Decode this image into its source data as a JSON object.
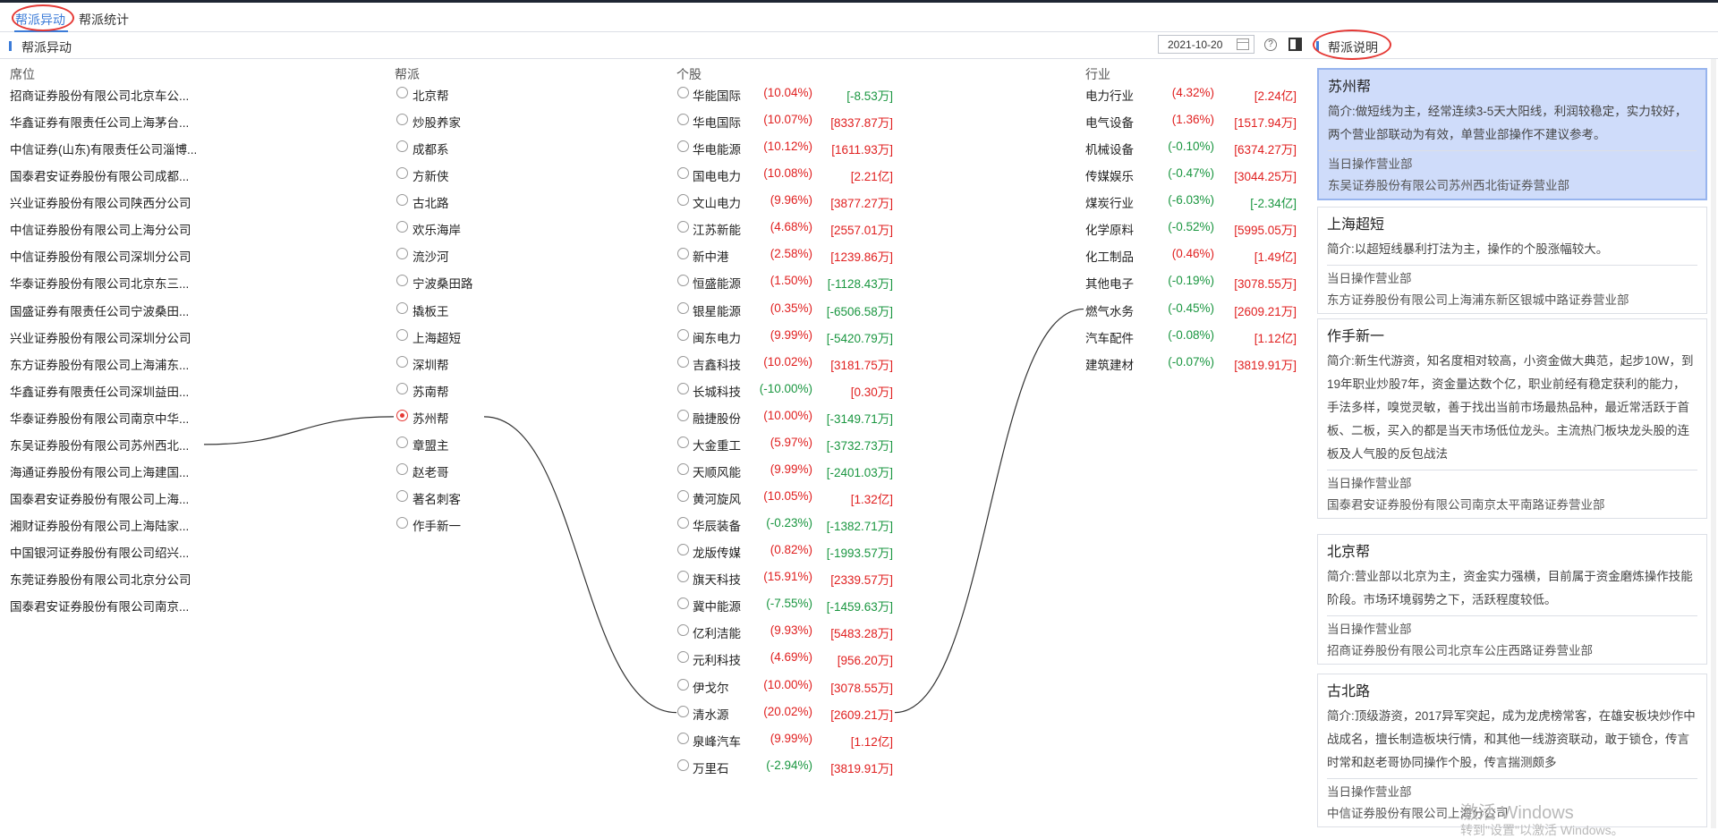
{
  "tabs": [
    {
      "label": "帮派异动",
      "active": true
    },
    {
      "label": "帮派统计",
      "active": false
    }
  ],
  "left_panel": {
    "title": "帮派异动",
    "date": "2021-10-20"
  },
  "right_panel": {
    "title": "帮派说明"
  },
  "columns": {
    "seat": "席位",
    "gang": "帮派",
    "stock": "个股",
    "industry": "行业"
  },
  "seats": [
    "招商证券股份有限公司北京车公...",
    "华鑫证券有限责任公司上海茅台...",
    "中信证券(山东)有限责任公司淄博...",
    "国泰君安证券股份有限公司成都...",
    "兴业证券股份有限公司陕西分公司",
    "中信证券股份有限公司上海分公司",
    "中信证券股份有限公司深圳分公司",
    "华泰证券股份有限公司北京东三...",
    "国盛证券有限责任公司宁波桑田...",
    "兴业证券股份有限公司深圳分公司",
    "东方证券股份有限公司上海浦东...",
    "华鑫证券有限责任公司深圳益田...",
    "华泰证券股份有限公司南京中华...",
    "东吴证券股份有限公司苏州西北...",
    "海通证券股份有限公司上海建国...",
    "国泰君安证券股份有限公司上海...",
    "湘财证券股份有限公司上海陆家...",
    "中国银河证券股份有限公司绍兴...",
    "东莞证券股份有限公司北京分公司",
    "国泰君安证券股份有限公司南京..."
  ],
  "gangs": [
    {
      "label": "北京帮",
      "checked": false
    },
    {
      "label": "炒股养家",
      "checked": false
    },
    {
      "label": "成都系",
      "checked": false
    },
    {
      "label": "方新侠",
      "checked": false
    },
    {
      "label": "古北路",
      "checked": false
    },
    {
      "label": "欢乐海岸",
      "checked": false
    },
    {
      "label": "流沙河",
      "checked": false
    },
    {
      "label": "宁波桑田路",
      "checked": false
    },
    {
      "label": "撬板王",
      "checked": false
    },
    {
      "label": "上海超短",
      "checked": false
    },
    {
      "label": "深圳帮",
      "checked": false
    },
    {
      "label": "苏南帮",
      "checked": false
    },
    {
      "label": "苏州帮",
      "checked": true
    },
    {
      "label": "章盟主",
      "checked": false
    },
    {
      "label": "赵老哥",
      "checked": false
    },
    {
      "label": "著名刺客",
      "checked": false
    },
    {
      "label": "作手新一",
      "checked": false
    }
  ],
  "stocks": [
    {
      "name": "华能国际",
      "pct": "(10.04%)",
      "amount": "[-8.53万]",
      "pct_color": "red",
      "amount_color": "green"
    },
    {
      "name": "华电国际",
      "pct": "(10.07%)",
      "amount": "[8337.87万]",
      "pct_color": "red",
      "amount_color": "red"
    },
    {
      "name": "华电能源",
      "pct": "(10.12%)",
      "amount": "[1611.93万]",
      "pct_color": "red",
      "amount_color": "red"
    },
    {
      "name": "国电电力",
      "pct": "(10.08%)",
      "amount": "[2.21亿]",
      "pct_color": "red",
      "amount_color": "red"
    },
    {
      "name": "文山电力",
      "pct": "(9.96%)",
      "amount": "[3877.27万]",
      "pct_color": "red",
      "amount_color": "red"
    },
    {
      "name": "江苏新能",
      "pct": "(4.68%)",
      "amount": "[2557.01万]",
      "pct_color": "red",
      "amount_color": "red"
    },
    {
      "name": "新中港",
      "pct": "(2.58%)",
      "amount": "[1239.86万]",
      "pct_color": "red",
      "amount_color": "red"
    },
    {
      "name": "恒盛能源",
      "pct": "(1.50%)",
      "amount": "[-1128.43万]",
      "pct_color": "red",
      "amount_color": "green"
    },
    {
      "name": "银星能源",
      "pct": "(0.35%)",
      "amount": "[-6506.58万]",
      "pct_color": "red",
      "amount_color": "green"
    },
    {
      "name": "闽东电力",
      "pct": "(9.99%)",
      "amount": "[-5420.79万]",
      "pct_color": "red",
      "amount_color": "green"
    },
    {
      "name": "吉鑫科技",
      "pct": "(10.02%)",
      "amount": "[3181.75万]",
      "pct_color": "red",
      "amount_color": "red"
    },
    {
      "name": "长城科技",
      "pct": "(-10.00%)",
      "amount": "[0.30万]",
      "pct_color": "green",
      "amount_color": "red"
    },
    {
      "name": "融捷股份",
      "pct": "(10.00%)",
      "amount": "[-3149.71万]",
      "pct_color": "red",
      "amount_color": "green"
    },
    {
      "name": "大金重工",
      "pct": "(5.97%)",
      "amount": "[-3732.73万]",
      "pct_color": "red",
      "amount_color": "green"
    },
    {
      "name": "天顺风能",
      "pct": "(9.99%)",
      "amount": "[-2401.03万]",
      "pct_color": "red",
      "amount_color": "green"
    },
    {
      "name": "黄河旋风",
      "pct": "(10.05%)",
      "amount": "[1.32亿]",
      "pct_color": "red",
      "amount_color": "red"
    },
    {
      "name": "华辰装备",
      "pct": "(-0.23%)",
      "amount": "[-1382.71万]",
      "pct_color": "green",
      "amount_color": "green"
    },
    {
      "name": "龙版传媒",
      "pct": "(0.82%)",
      "amount": "[-1993.57万]",
      "pct_color": "red",
      "amount_color": "green"
    },
    {
      "name": "旗天科技",
      "pct": "(15.91%)",
      "amount": "[2339.57万]",
      "pct_color": "red",
      "amount_color": "red"
    },
    {
      "name": "冀中能源",
      "pct": "(-7.55%)",
      "amount": "[-1459.63万]",
      "pct_color": "green",
      "amount_color": "green"
    },
    {
      "name": "亿利洁能",
      "pct": "(9.93%)",
      "amount": "[5483.28万]",
      "pct_color": "red",
      "amount_color": "red"
    },
    {
      "name": "元利科技",
      "pct": "(4.69%)",
      "amount": "[956.20万]",
      "pct_color": "red",
      "amount_color": "red"
    },
    {
      "name": "伊戈尔",
      "pct": "(10.00%)",
      "amount": "[3078.55万]",
      "pct_color": "red",
      "amount_color": "red"
    },
    {
      "name": "清水源",
      "pct": "(20.02%)",
      "amount": "[2609.21万]",
      "pct_color": "red",
      "amount_color": "red"
    },
    {
      "name": "泉峰汽车",
      "pct": "(9.99%)",
      "amount": "[1.12亿]",
      "pct_color": "red",
      "amount_color": "red"
    },
    {
      "name": "万里石",
      "pct": "(-2.94%)",
      "amount": "[3819.91万]",
      "pct_color": "green",
      "amount_color": "red"
    }
  ],
  "industries": [
    {
      "name": "电力行业",
      "pct": "(4.32%)",
      "amount": "[2.24亿]",
      "pct_color": "red",
      "amount_color": "red"
    },
    {
      "name": "电气设备",
      "pct": "(1.36%)",
      "amount": "[1517.94万]",
      "pct_color": "red",
      "amount_color": "red"
    },
    {
      "name": "机械设备",
      "pct": "(-0.10%)",
      "amount": "[6374.27万]",
      "pct_color": "green",
      "amount_color": "red"
    },
    {
      "name": "传媒娱乐",
      "pct": "(-0.47%)",
      "amount": "[3044.25万]",
      "pct_color": "green",
      "amount_color": "red"
    },
    {
      "name": "煤炭行业",
      "pct": "(-6.03%)",
      "amount": "[-2.34亿]",
      "pct_color": "green",
      "amount_color": "green"
    },
    {
      "name": "化学原料",
      "pct": "(-0.52%)",
      "amount": "[5995.05万]",
      "pct_color": "green",
      "amount_color": "red"
    },
    {
      "name": "化工制品",
      "pct": "(0.46%)",
      "amount": "[1.49亿]",
      "pct_color": "red",
      "amount_color": "red"
    },
    {
      "name": "其他电子",
      "pct": "(-0.19%)",
      "amount": "[3078.55万]",
      "pct_color": "green",
      "amount_color": "red"
    },
    {
      "name": "燃气水务",
      "pct": "(-0.45%)",
      "amount": "[2609.21万]",
      "pct_color": "green",
      "amount_color": "red"
    },
    {
      "name": "汽车配件",
      "pct": "(-0.08%)",
      "amount": "[1.12亿]",
      "pct_color": "green",
      "amount_color": "red"
    },
    {
      "name": "建筑建材",
      "pct": "(-0.07%)",
      "amount": "[3819.91万]",
      "pct_color": "green",
      "amount_color": "red"
    }
  ],
  "links": {
    "seat_index": 13,
    "gang_index": 12,
    "stock_index": 23,
    "industry_index": 8
  },
  "cards": [
    {
      "title": "苏州帮",
      "intro": "简介:做短线为主，经常连续3-5天大阳线，利润较稳定，实力较好，两个营业部联动为有效，单营业部操作不建议参考。",
      "sub": "当日操作营业部",
      "dept": "东吴证券股份有限公司苏州西北街证券营业部",
      "active": true
    },
    {
      "title": "上海超短",
      "intro": "简介:以超短线暴利打法为主，操作的个股涨幅较大。",
      "sub": "当日操作营业部",
      "dept": "东方证券股份有限公司上海浦东新区银城中路证券营业部",
      "active": false
    },
    {
      "title": "作手新一",
      "intro": "简介:新生代游资，知名度相对较高，小资金做大典范，起步10W，到19年职业炒股7年，资金量达数个亿，职业前经有稳定获利的能力，手法多样，嗅觉灵敏，善于找出当前市场最热品种，最近常活跃于首板、二板，买入的都是当天市场低位龙头。主流热门板块龙头股的连板及人气股的反包战法",
      "sub": "当日操作营业部",
      "dept": "国泰君安证券股份有限公司南京太平南路证券营业部",
      "active": false
    },
    {
      "title": "北京帮",
      "intro": "简介:营业部以北京为主，资金实力强横，目前属于资金磨炼操作技能阶段。市场环境弱势之下，活跃程度较低。",
      "sub": "当日操作营业部",
      "dept": "招商证券股份有限公司北京车公庄西路证券营业部",
      "active": false
    },
    {
      "title": "古北路",
      "intro": "简介:顶级游资，2017异军突起，成为龙虎榜常客，在雄安板块炒作中战成名，擅长制造板块行情，和其他一线游资联动，敢于锁仓，传言时常和赵老哥协同操作个股，传言揣测颇多",
      "sub": "当日操作营业部",
      "dept": "中信证券股份有限公司上海分公司",
      "active": false
    }
  ],
  "watermark": {
    "line1": "激活 Windows",
    "line2": "转到\"设置\"以激活 Windows。"
  },
  "colors": {
    "accent": "#3b7bd8",
    "up": "#e02020",
    "down": "#1a9640",
    "active_card": "#cfdcfa"
  }
}
